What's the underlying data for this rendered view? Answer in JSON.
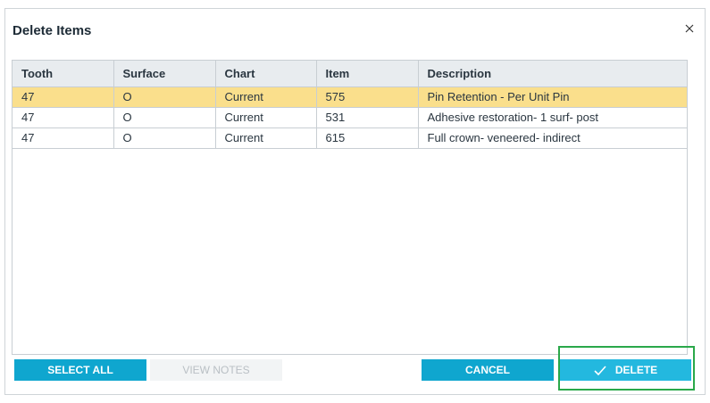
{
  "dialog": {
    "title": "Delete Items",
    "close_icon": "close-icon"
  },
  "grid": {
    "columns": [
      "Tooth",
      "Surface",
      "Chart",
      "Item",
      "Description"
    ],
    "rows": [
      {
        "tooth": "47",
        "surface": "O",
        "chart": "Current",
        "item": "575",
        "description": "Pin Retention - Per Unit Pin",
        "selected": true
      },
      {
        "tooth": "47",
        "surface": "O",
        "chart": "Current",
        "item": "531",
        "description": "Adhesive restoration- 1 surf- post",
        "selected": false
      },
      {
        "tooth": "47",
        "surface": "O",
        "chart": "Current",
        "item": "615",
        "description": "Full crown- veneered- indirect",
        "selected": false
      }
    ]
  },
  "buttons": {
    "select_all": "SELECT ALL",
    "view_notes": "VIEW NOTES",
    "cancel": "CANCEL",
    "delete": "DELETE",
    "delete_icon": "check-icon"
  },
  "colors": {
    "selected_row": "#fadf8c",
    "button": "#0fa6cf",
    "focus_ring": "#2aa84a"
  }
}
